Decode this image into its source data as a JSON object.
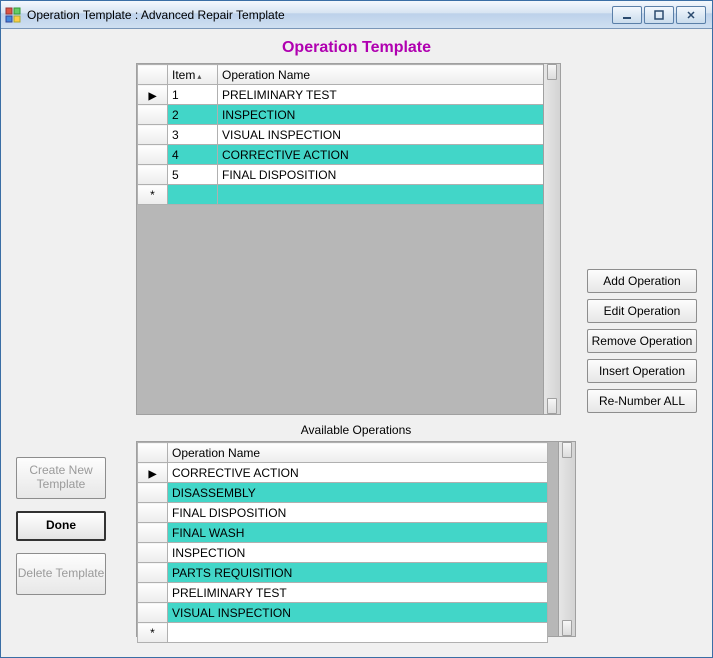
{
  "window": {
    "title": "Operation Template : Advanced Repair Template"
  },
  "page": {
    "heading": "Operation Template",
    "available_label": "Available Operations"
  },
  "grid_top": {
    "columns": {
      "item": "Item",
      "opname": "Operation Name"
    },
    "rows": [
      {
        "marker": "▶",
        "item": "1",
        "name": "PRELIMINARY TEST"
      },
      {
        "marker": "",
        "item": "2",
        "name": "INSPECTION"
      },
      {
        "marker": "",
        "item": "3",
        "name": "VISUAL INSPECTION"
      },
      {
        "marker": "",
        "item": "4",
        "name": "CORRECTIVE ACTION"
      },
      {
        "marker": "",
        "item": "5",
        "name": "FINAL DISPOSITION"
      }
    ],
    "new_row_marker": "*"
  },
  "grid_bottom": {
    "columns": {
      "opname": "Operation Name"
    },
    "rows": [
      {
        "marker": "▶",
        "name": "CORRECTIVE ACTION"
      },
      {
        "marker": "",
        "name": "DISASSEMBLY"
      },
      {
        "marker": "",
        "name": "FINAL DISPOSITION"
      },
      {
        "marker": "",
        "name": "FINAL WASH"
      },
      {
        "marker": "",
        "name": "INSPECTION"
      },
      {
        "marker": "",
        "name": "PARTS REQUISITION"
      },
      {
        "marker": "",
        "name": "PRELIMINARY TEST"
      },
      {
        "marker": "",
        "name": "VISUAL INSPECTION"
      }
    ],
    "new_row_marker": "*"
  },
  "side_buttons": {
    "add": "Add Operation",
    "edit": "Edit Operation",
    "remove": "Remove Operation",
    "insert": "Insert Operation",
    "renumber": "Re-Number ALL"
  },
  "left_buttons": {
    "create": "Create New Template",
    "done": "Done",
    "delete": "Delete Template"
  }
}
